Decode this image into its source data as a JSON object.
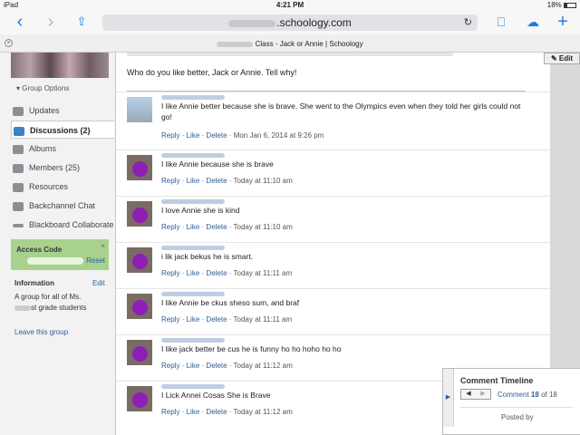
{
  "status_bar": {
    "carrier": "iPad",
    "time": "4:21 PM",
    "battery": "18%"
  },
  "browser": {
    "url_domain": ".schoology.com",
    "tab_title": "Class - Jack or Annie | Schoology"
  },
  "sidebar": {
    "group_options": "Group Options",
    "items": [
      {
        "label": "Updates"
      },
      {
        "label": "Discussions (2)"
      },
      {
        "label": "Albums"
      },
      {
        "label": "Members (25)"
      },
      {
        "label": "Resources"
      },
      {
        "label": "Backchannel Chat"
      },
      {
        "label": "Blackboard Collaborate"
      }
    ],
    "access_code": {
      "label": "Access Code",
      "reset": "Reset",
      "close": "×"
    },
    "information": {
      "heading": "Information",
      "edit": "Edit",
      "line1": "A group for all of Ms.",
      "line2": "st grade students"
    },
    "leave": "Leave this group"
  },
  "main": {
    "edit_button": "Edit",
    "question": "Who do you like better, Jack or Annie. Tell why!",
    "comments": [
      {
        "text": "I like Annie better because she is brave. She went to the Olympics even when they told her girls could not go!",
        "timestamp": "Mon Jan 6, 2014 at 9:26 pm"
      },
      {
        "text": "I like Annie because she is brave",
        "timestamp": "Today at 11:10 am"
      },
      {
        "text": "I love Annie she is kind",
        "timestamp": "Today at 11:10 am"
      },
      {
        "text": "i lik jack bekus he is smart.",
        "timestamp": "Today at 11:11 am"
      },
      {
        "text": "I like Annie be ckus sheso sum, and braf",
        "timestamp": "Today at 11:11 am"
      },
      {
        "text": "I like jack better be cus he is funny ho ho hoho ho ho",
        "timestamp": "Today at 11:12 am"
      },
      {
        "text": "I Lick Annei Cosas She is Brave",
        "timestamp": "Today at 11:12 am"
      }
    ],
    "actions": {
      "reply": "Reply",
      "like": "Like",
      "delete": "Delete",
      "sep": "·"
    }
  },
  "timeline": {
    "title": "Comment Timeline",
    "prev": "◀",
    "next": "▶",
    "label": "Comment",
    "current": "18",
    "of": "of 18",
    "posted_by": "Posted by"
  },
  "colors": {
    "accent_link": "#2b5f99",
    "access_bg": "#a9d18e",
    "ios_blue": "#1a7fe3",
    "avatar_dot": "#8e1fb6"
  }
}
